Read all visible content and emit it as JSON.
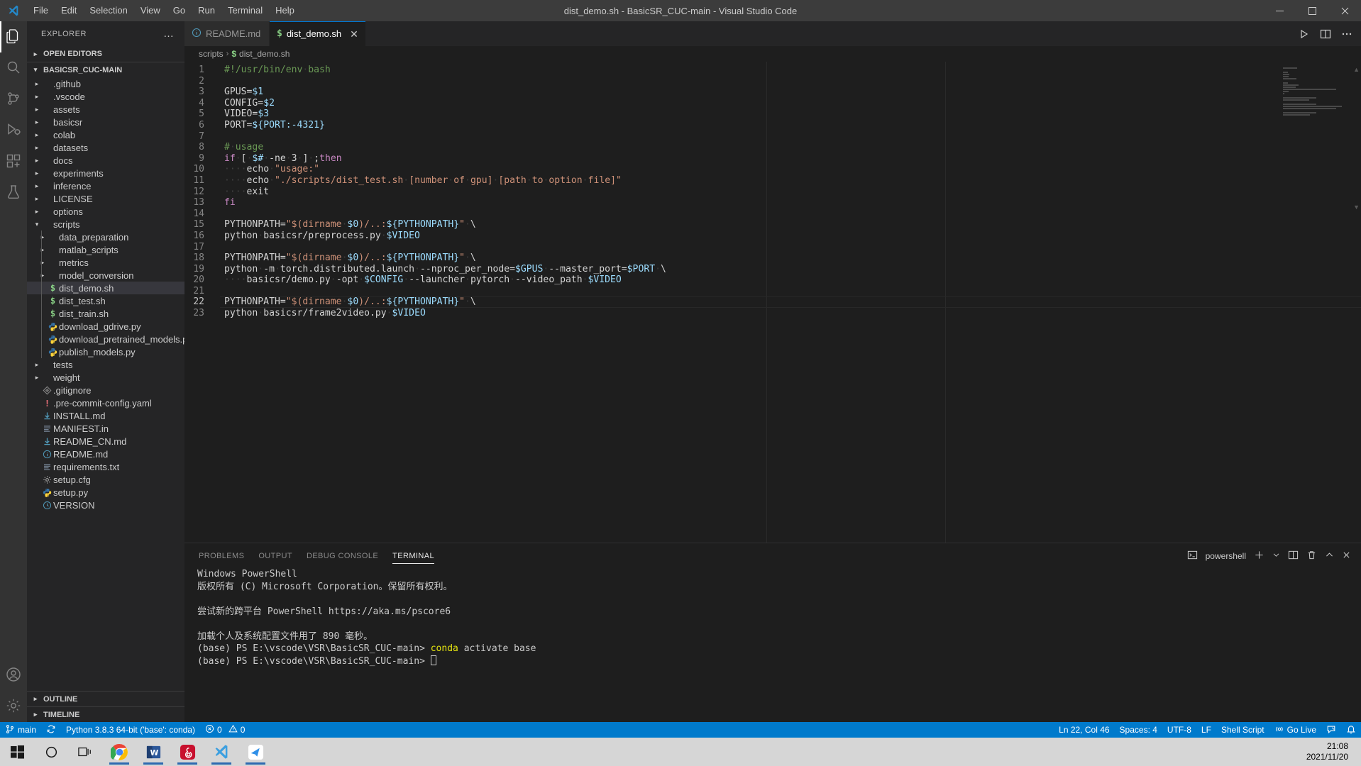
{
  "window": {
    "title": "dist_demo.sh - BasicSR_CUC-main - Visual Studio Code",
    "minimize": "─",
    "maximize": "☐",
    "close": "✕"
  },
  "menu": [
    "File",
    "Edit",
    "Selection",
    "View",
    "Go",
    "Run",
    "Terminal",
    "Help"
  ],
  "activity_bar": [
    {
      "name": "explorer",
      "icon": "files-icon",
      "active": true
    },
    {
      "name": "search",
      "icon": "search-icon",
      "active": false
    },
    {
      "name": "source-control",
      "icon": "source-control-icon",
      "active": false
    },
    {
      "name": "run-debug",
      "icon": "run-debug-icon",
      "active": false
    },
    {
      "name": "extensions",
      "icon": "extensions-icon",
      "active": false
    },
    {
      "name": "testing",
      "icon": "beaker-icon",
      "active": false
    },
    {
      "name": "accounts",
      "icon": "account-icon",
      "active": false
    },
    {
      "name": "settings",
      "icon": "gear-icon",
      "active": false
    }
  ],
  "sidebar": {
    "title": "EXPLORER",
    "more_actions": "…",
    "sections": {
      "open_editors": "OPEN EDITORS",
      "folder": "BASICSR_CUC-MAIN",
      "outline": "OUTLINE",
      "timeline": "TIMELINE"
    },
    "tree": [
      {
        "label": ".github",
        "type": "folder",
        "depth": 1,
        "expanded": false
      },
      {
        "label": ".vscode",
        "type": "folder",
        "depth": 1,
        "expanded": false
      },
      {
        "label": "assets",
        "type": "folder",
        "depth": 1,
        "expanded": false
      },
      {
        "label": "basicsr",
        "type": "folder",
        "depth": 1,
        "expanded": false
      },
      {
        "label": "colab",
        "type": "folder",
        "depth": 1,
        "expanded": false
      },
      {
        "label": "datasets",
        "type": "folder",
        "depth": 1,
        "expanded": false
      },
      {
        "label": "docs",
        "type": "folder",
        "depth": 1,
        "expanded": false
      },
      {
        "label": "experiments",
        "type": "folder",
        "depth": 1,
        "expanded": false
      },
      {
        "label": "inference",
        "type": "folder",
        "depth": 1,
        "expanded": false
      },
      {
        "label": "LICENSE",
        "type": "folder",
        "depth": 1,
        "expanded": false
      },
      {
        "label": "options",
        "type": "folder",
        "depth": 1,
        "expanded": false
      },
      {
        "label": "scripts",
        "type": "folder",
        "depth": 1,
        "expanded": true
      },
      {
        "label": "data_preparation",
        "type": "folder",
        "depth": 2,
        "expanded": false
      },
      {
        "label": "matlab_scripts",
        "type": "folder",
        "depth": 2,
        "expanded": false
      },
      {
        "label": "metrics",
        "type": "folder",
        "depth": 2,
        "expanded": false
      },
      {
        "label": "model_conversion",
        "type": "folder",
        "depth": 2,
        "expanded": false
      },
      {
        "label": "dist_demo.sh",
        "type": "shell",
        "depth": 2,
        "selected": true
      },
      {
        "label": "dist_test.sh",
        "type": "shell",
        "depth": 2
      },
      {
        "label": "dist_train.sh",
        "type": "shell",
        "depth": 2
      },
      {
        "label": "download_gdrive.py",
        "type": "python",
        "depth": 2
      },
      {
        "label": "download_pretrained_models.py",
        "type": "python",
        "depth": 2
      },
      {
        "label": "publish_models.py",
        "type": "python",
        "depth": 2
      },
      {
        "label": "tests",
        "type": "folder",
        "depth": 1,
        "expanded": false
      },
      {
        "label": "weight",
        "type": "folder",
        "depth": 1,
        "expanded": false
      },
      {
        "label": ".gitignore",
        "type": "git",
        "depth": 1
      },
      {
        "label": ".pre-commit-config.yaml",
        "type": "yaml",
        "depth": 1
      },
      {
        "label": "INSTALL.md",
        "type": "markdown",
        "depth": 1
      },
      {
        "label": "MANIFEST.in",
        "type": "text",
        "depth": 1
      },
      {
        "label": "README_CN.md",
        "type": "markdown",
        "depth": 1
      },
      {
        "label": "README.md",
        "type": "info",
        "depth": 1
      },
      {
        "label": "requirements.txt",
        "type": "text",
        "depth": 1
      },
      {
        "label": "setup.cfg",
        "type": "config",
        "depth": 1
      },
      {
        "label": "setup.py",
        "type": "python",
        "depth": 1
      },
      {
        "label": "VERSION",
        "type": "version",
        "depth": 1
      }
    ]
  },
  "editor": {
    "tabs": [
      {
        "label": "README.md",
        "icon": "info-icon",
        "active": false,
        "dirty": false
      },
      {
        "label": "dist_demo.sh",
        "icon": "shell-icon",
        "active": true,
        "close": "✕"
      }
    ],
    "actions": [
      "run-icon",
      "split-editor-icon",
      "more-actions-icon"
    ],
    "breadcrumb": [
      "scripts",
      "dist_demo.sh"
    ],
    "active_line": 22,
    "lines": [
      {
        "n": 1,
        "tokens": [
          {
            "t": "#!/usr/bin/env bash",
            "c": "t-comment"
          }
        ]
      },
      {
        "n": 2,
        "tokens": []
      },
      {
        "n": 3,
        "tokens": [
          {
            "t": "GPUS=",
            "c": "t-plain"
          },
          {
            "t": "$1",
            "c": "t-var"
          }
        ]
      },
      {
        "n": 4,
        "tokens": [
          {
            "t": "CONFIG=",
            "c": "t-plain"
          },
          {
            "t": "$2",
            "c": "t-var"
          }
        ]
      },
      {
        "n": 5,
        "tokens": [
          {
            "t": "VIDEO=",
            "c": "t-plain"
          },
          {
            "t": "$3",
            "c": "t-var"
          }
        ]
      },
      {
        "n": 6,
        "tokens": [
          {
            "t": "PORT=",
            "c": "t-plain"
          },
          {
            "t": "${PORT:-4321}",
            "c": "t-var"
          }
        ]
      },
      {
        "n": 7,
        "tokens": []
      },
      {
        "n": 8,
        "tokens": [
          {
            "t": "# usage",
            "c": "t-comment"
          }
        ]
      },
      {
        "n": 9,
        "tokens": [
          {
            "t": "if",
            "c": "t-kw"
          },
          {
            "t": " [ ",
            "c": "t-plain"
          },
          {
            "t": "$#",
            "c": "t-var"
          },
          {
            "t": " -ne 3 ] ;",
            "c": "t-plain"
          },
          {
            "t": "then",
            "c": "t-kw"
          }
        ]
      },
      {
        "n": 10,
        "tokens": [
          {
            "t": "    ",
            "c": "ws"
          },
          {
            "t": "echo ",
            "c": "t-plain"
          },
          {
            "t": "\"usage:\"",
            "c": "t-str"
          }
        ]
      },
      {
        "n": 11,
        "tokens": [
          {
            "t": "    ",
            "c": "ws"
          },
          {
            "t": "echo ",
            "c": "t-plain"
          },
          {
            "t": "\"./scripts/dist_test.sh [number of gpu] [path to option file]\"",
            "c": "t-str"
          }
        ]
      },
      {
        "n": 12,
        "tokens": [
          {
            "t": "    ",
            "c": "ws"
          },
          {
            "t": "exit",
            "c": "t-plain"
          }
        ]
      },
      {
        "n": 13,
        "tokens": [
          {
            "t": "fi",
            "c": "t-kw"
          }
        ]
      },
      {
        "n": 14,
        "tokens": []
      },
      {
        "n": 15,
        "tokens": [
          {
            "t": "PYTHONPATH=",
            "c": "t-plain"
          },
          {
            "t": "\"$(dirname ",
            "c": "t-str"
          },
          {
            "t": "$0",
            "c": "t-var"
          },
          {
            "t": ")/..:",
            "c": "t-str"
          },
          {
            "t": "${PYTHONPATH}",
            "c": "t-var"
          },
          {
            "t": "\"",
            "c": "t-str"
          },
          {
            "t": " \\",
            "c": "t-plain"
          }
        ]
      },
      {
        "n": 16,
        "tokens": [
          {
            "t": "python basicsr/preprocess.py ",
            "c": "t-plain"
          },
          {
            "t": "$VIDEO",
            "c": "t-var"
          }
        ]
      },
      {
        "n": 17,
        "tokens": []
      },
      {
        "n": 18,
        "tokens": [
          {
            "t": "PYTHONPATH=",
            "c": "t-plain"
          },
          {
            "t": "\"$(dirname ",
            "c": "t-str"
          },
          {
            "t": "$0",
            "c": "t-var"
          },
          {
            "t": ")/..:",
            "c": "t-str"
          },
          {
            "t": "${PYTHONPATH}",
            "c": "t-var"
          },
          {
            "t": "\"",
            "c": "t-str"
          },
          {
            "t": " \\",
            "c": "t-plain"
          }
        ]
      },
      {
        "n": 19,
        "tokens": [
          {
            "t": "python -m torch.distributed.launch --nproc_per_node=",
            "c": "t-plain"
          },
          {
            "t": "$GPUS",
            "c": "t-var"
          },
          {
            "t": " --master_port=",
            "c": "t-plain"
          },
          {
            "t": "$PORT",
            "c": "t-var"
          },
          {
            "t": " \\",
            "c": "t-plain"
          }
        ]
      },
      {
        "n": 20,
        "tokens": [
          {
            "t": "    ",
            "c": "ws"
          },
          {
            "t": "basicsr/demo.py -opt ",
            "c": "t-plain"
          },
          {
            "t": "$CONFIG",
            "c": "t-var"
          },
          {
            "t": " --launcher pytorch --video_path ",
            "c": "t-plain"
          },
          {
            "t": "$VIDEO",
            "c": "t-var"
          }
        ]
      },
      {
        "n": 21,
        "tokens": []
      },
      {
        "n": 22,
        "tokens": [
          {
            "t": "PYTHONPATH=",
            "c": "t-plain"
          },
          {
            "t": "\"$(dirname ",
            "c": "t-str"
          },
          {
            "t": "$0",
            "c": "t-var"
          },
          {
            "t": ")/..:",
            "c": "t-str"
          },
          {
            "t": "${PYTHONPATH}",
            "c": "t-var"
          },
          {
            "t": "\"",
            "c": "t-str"
          },
          {
            "t": " \\",
            "c": "t-plain"
          }
        ]
      },
      {
        "n": 23,
        "tokens": [
          {
            "t": "python basicsr/frame2video.py ",
            "c": "t-plain"
          },
          {
            "t": "$VIDEO",
            "c": "t-var"
          }
        ]
      }
    ]
  },
  "panel": {
    "tabs": [
      {
        "label": "PROBLEMS",
        "active": false
      },
      {
        "label": "OUTPUT",
        "active": false
      },
      {
        "label": "DEBUG CONSOLE",
        "active": false
      },
      {
        "label": "TERMINAL",
        "active": true
      }
    ],
    "shell_name": "powershell",
    "actions": [
      "add-terminal-icon",
      "chevron-down-icon",
      "split-terminal-icon",
      "kill-terminal-icon",
      "maximize-panel-icon",
      "close-panel-icon"
    ],
    "terminal_lines": [
      {
        "text": "Windows PowerShell"
      },
      {
        "text": "版权所有 (C) Microsoft Corporation。保留所有权利。"
      },
      {
        "text": ""
      },
      {
        "text": "尝试新的跨平台 PowerShell https://aka.ms/pscore6"
      },
      {
        "text": ""
      },
      {
        "text": "加载个人及系统配置文件用了 890 毫秒。"
      },
      {
        "prompt": "(base) PS E:\\vscode\\VSR\\BasicSR_CUC-main> ",
        "cmd": "conda",
        "rest": " activate base"
      },
      {
        "prompt": "(base) PS E:\\vscode\\VSR\\BasicSR_CUC-main> ",
        "cursor": true
      }
    ]
  },
  "statusbar": {
    "left": [
      {
        "name": "remote-branch",
        "icon": "branch-icon",
        "label": "main"
      },
      {
        "name": "sync",
        "icon": "sync-icon",
        "label": ""
      },
      {
        "name": "python-interpreter",
        "icon": "",
        "label": "Python 3.8.3 64-bit ('base': conda)"
      },
      {
        "name": "problems",
        "icon": "error-warning-icon",
        "label": "0  0",
        "errors": "0",
        "warnings": "0"
      }
    ],
    "right": [
      {
        "name": "cursor-position",
        "label": "Ln 22, Col 46"
      },
      {
        "name": "indentation",
        "label": "Spaces: 4"
      },
      {
        "name": "encoding",
        "label": "UTF-8"
      },
      {
        "name": "eol",
        "label": "LF"
      },
      {
        "name": "language-mode",
        "label": "Shell Script"
      },
      {
        "name": "go-live",
        "label": "Go Live",
        "icon": "broadcast-icon"
      },
      {
        "name": "feedback",
        "label": "",
        "icon": "feedback-icon"
      },
      {
        "name": "notifications",
        "label": "",
        "icon": "bell-icon"
      }
    ]
  },
  "taskbar": {
    "icons": [
      {
        "name": "start-button",
        "glyph": "windows"
      },
      {
        "name": "cortana-search",
        "glyph": "circle"
      },
      {
        "name": "task-view",
        "glyph": "taskview"
      },
      {
        "name": "chrome",
        "glyph": "chrome",
        "running": true
      },
      {
        "name": "word",
        "glyph": "word",
        "running": true
      },
      {
        "name": "netease-music",
        "glyph": "netease",
        "running": true
      },
      {
        "name": "vscode",
        "glyph": "vscode",
        "running": true
      },
      {
        "name": "app-blue",
        "glyph": "blueapp",
        "running": true
      }
    ],
    "time": "21:08",
    "date": "2021/11/20"
  },
  "colors": {
    "accent": "#007acc",
    "sidebar_bg": "#252526",
    "editor_bg": "#1e1e1e",
    "titlebar_bg": "#3c3c3c"
  }
}
